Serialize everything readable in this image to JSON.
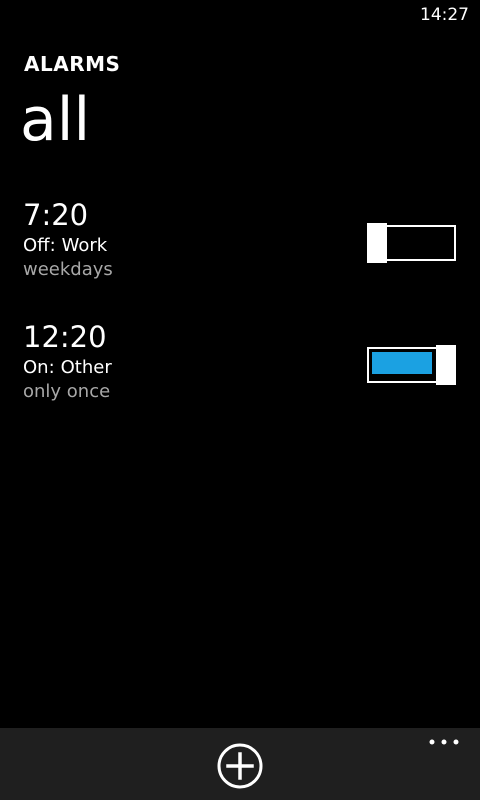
{
  "status_bar": {
    "time": "14:27"
  },
  "app": {
    "title": "ALARMS"
  },
  "pivot": {
    "header": "all"
  },
  "alarms": [
    {
      "time": "7:20",
      "state": "Off:",
      "name": "Work",
      "recurrence": "weekdays",
      "enabled": false
    },
    {
      "time": "12:20",
      "state": "On:",
      "name": "Other",
      "recurrence": "only once",
      "enabled": true
    }
  ],
  "app_bar": {
    "icons": [
      "add-icon",
      "more-icon"
    ]
  },
  "colors": {
    "background": "#000000",
    "accent": "#1ba1e2",
    "secondary_text": "#a8a8a8",
    "app_bar": "#1f1f1f"
  }
}
